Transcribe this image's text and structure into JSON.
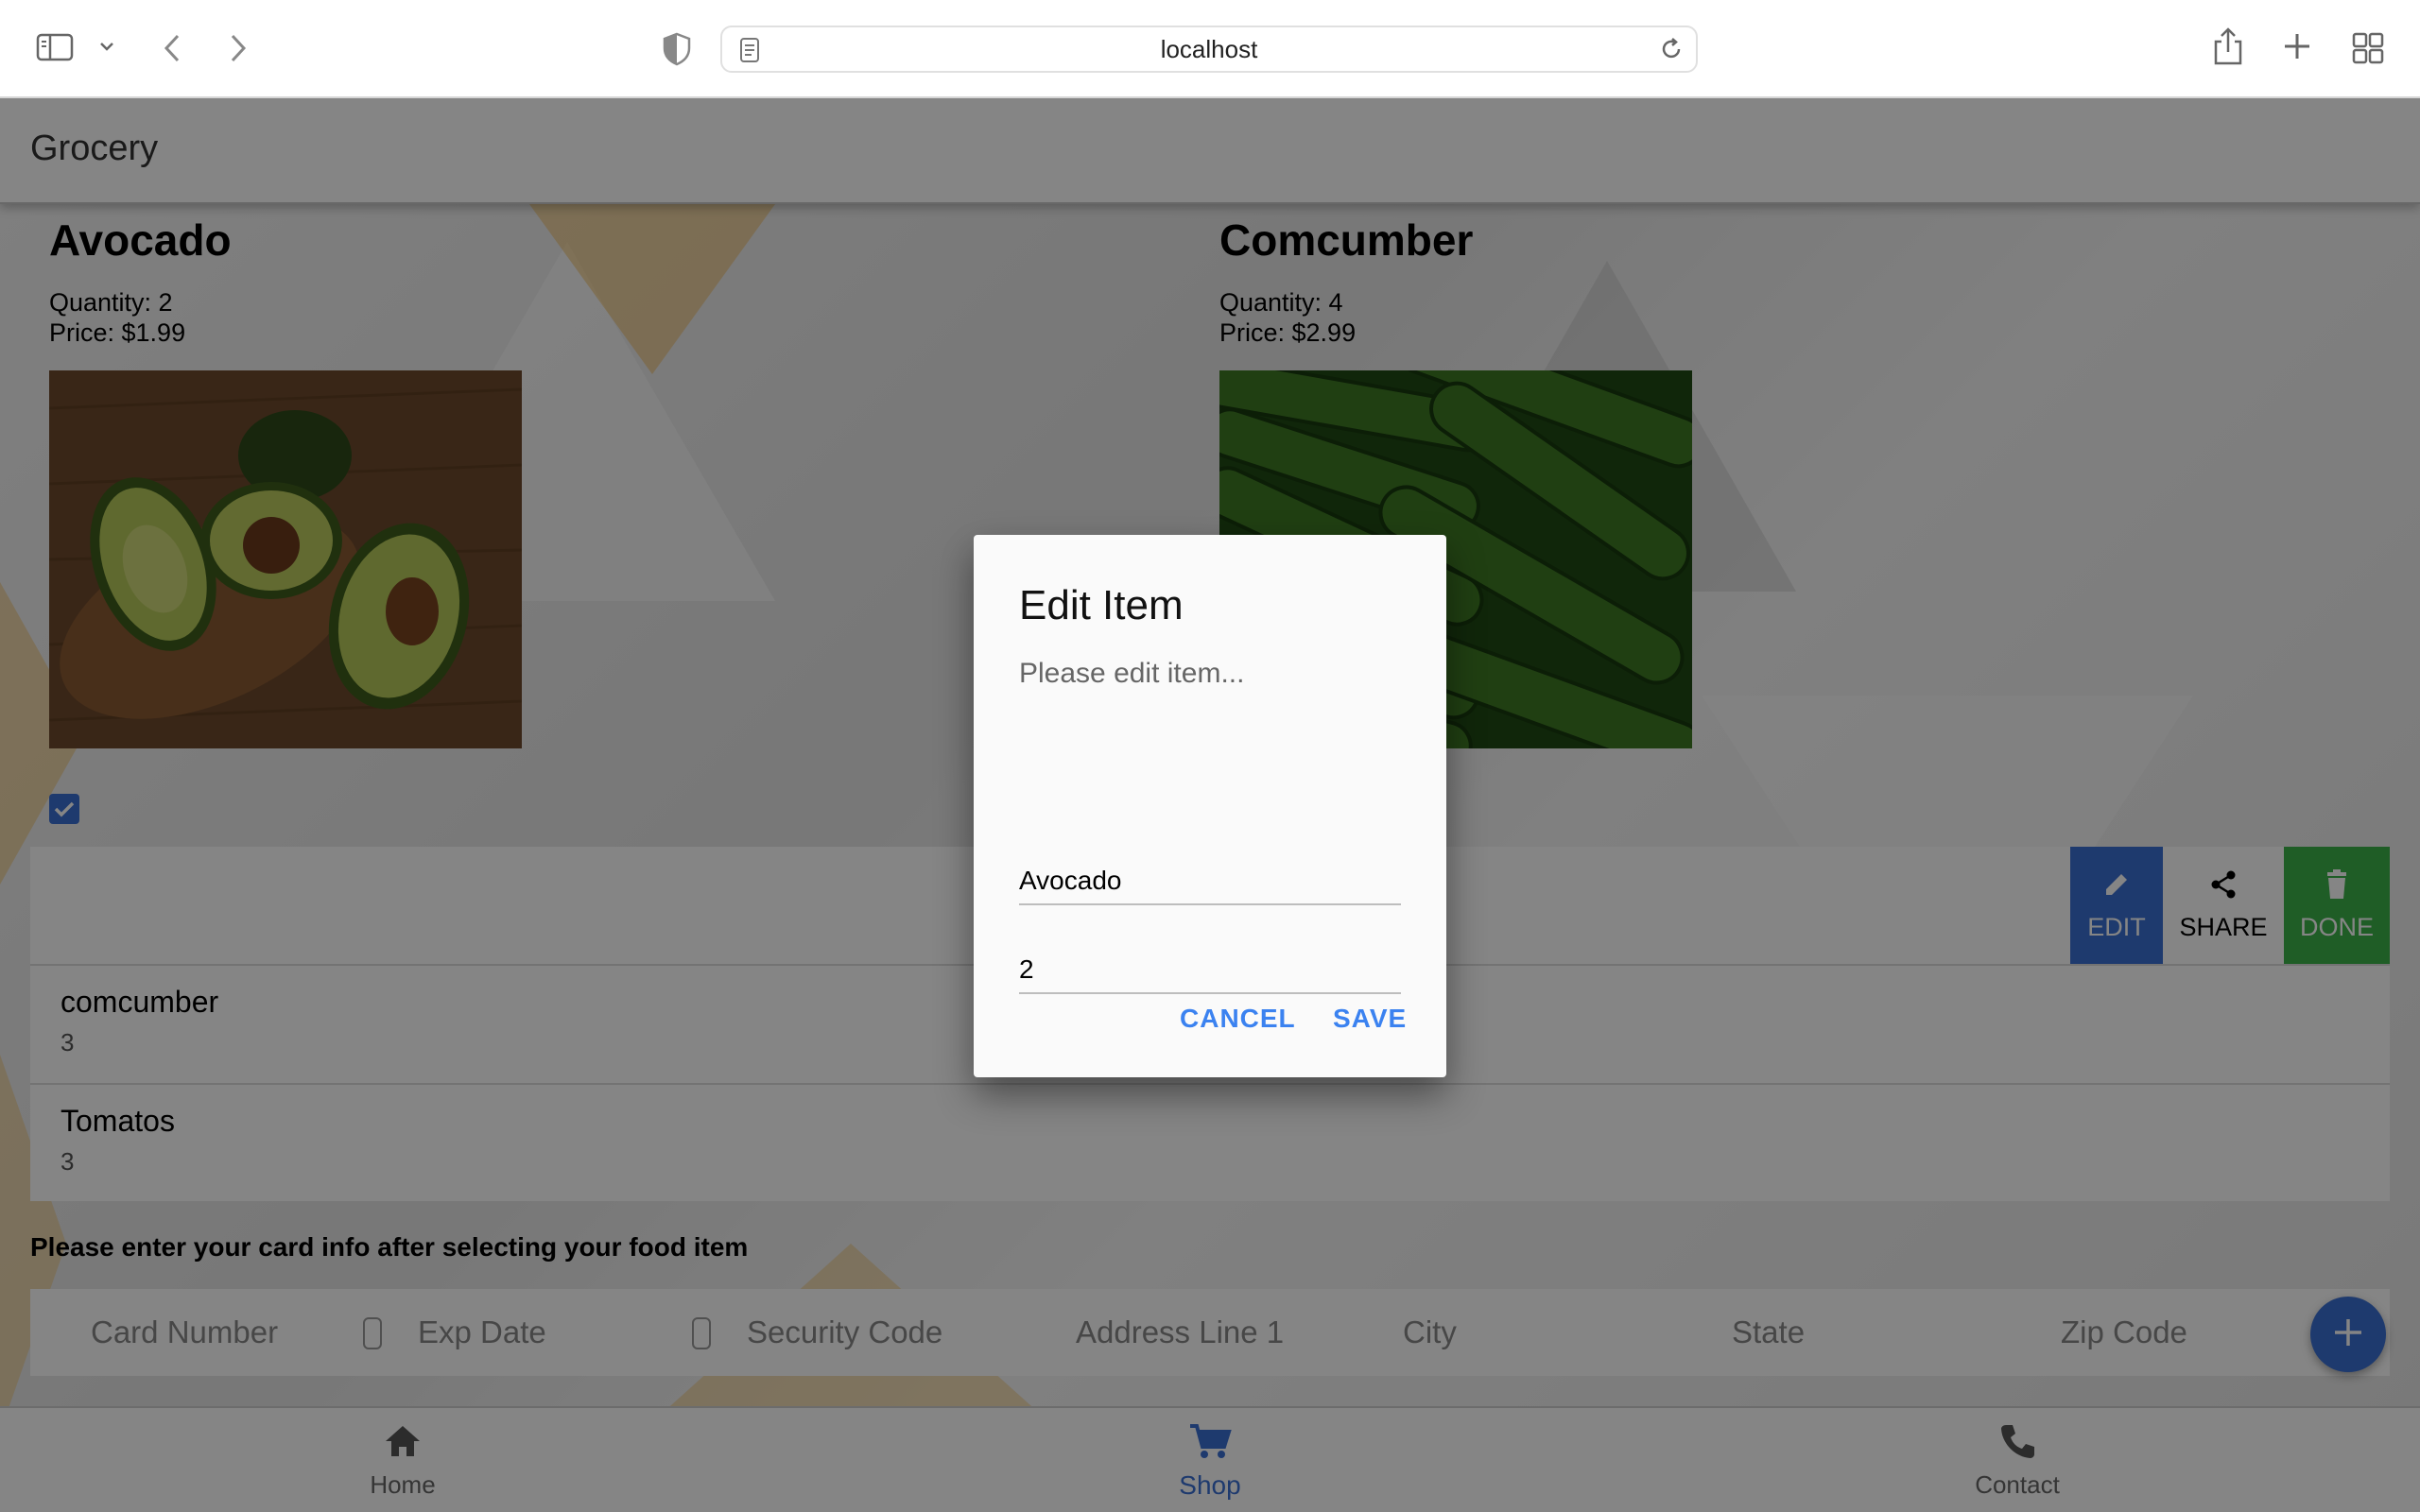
{
  "browser": {
    "url": "localhost",
    "icons": [
      "sidebar-icon",
      "chevron-down-icon",
      "back-icon",
      "forward-icon",
      "privacy-shield-icon",
      "page-icon",
      "reload-icon",
      "share-icon",
      "new-tab-icon",
      "tab-overview-icon"
    ]
  },
  "app": {
    "title": "Grocery"
  },
  "products": [
    {
      "name": "Avocado",
      "quantity": "Quantity: 2",
      "price": "Price: $1.99"
    },
    {
      "name": "Comcumber",
      "quantity": "Quantity: 4",
      "price": "Price: $2.99"
    }
  ],
  "list": {
    "items": [
      {
        "name": "comcumber",
        "qty": "3"
      },
      {
        "name": "Tomatos",
        "qty": "3"
      }
    ],
    "actions": {
      "edit": "EDIT",
      "share": "SHARE",
      "done": "DONE"
    }
  },
  "card": {
    "note": "Please enter your card info after selecting your food item",
    "fields": {
      "card_number": "Card Number",
      "exp_date": "Exp Date",
      "security_code": "Security Code",
      "address": "Address Line 1",
      "city": "City",
      "state": "State",
      "zip": "Zip Code"
    }
  },
  "nav": {
    "home": "Home",
    "shop": "Shop",
    "contact": "Contact"
  },
  "dialog": {
    "title": "Edit Item",
    "message": "Please edit item...",
    "name_value": "Avocado",
    "qty_value": "2",
    "cancel": "CANCEL",
    "save": "SAVE"
  },
  "colors": {
    "accent": "#3b6fd4",
    "edit": "#3b6fd4",
    "done": "#3cb34a",
    "dialog_button": "#3b82f0"
  }
}
